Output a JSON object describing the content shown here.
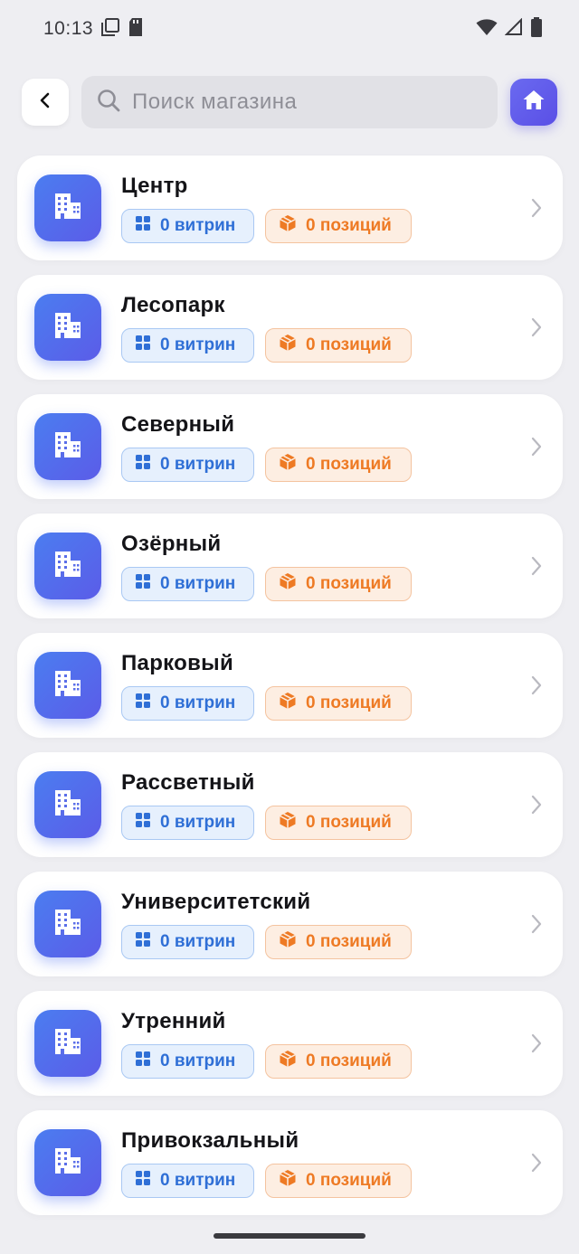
{
  "status_bar": {
    "time": "10:13"
  },
  "search": {
    "placeholder": "Поиск магазина",
    "value": ""
  },
  "stores": [
    {
      "name": "Центр",
      "showcases": "0 витрин",
      "positions": "0 позиций"
    },
    {
      "name": "Лесопарк",
      "showcases": "0 витрин",
      "positions": "0 позиций"
    },
    {
      "name": "Северный",
      "showcases": "0 витрин",
      "positions": "0 позиций"
    },
    {
      "name": "Озёрный",
      "showcases": "0 витрин",
      "positions": "0 позиций"
    },
    {
      "name": "Парковый",
      "showcases": "0 витрин",
      "positions": "0 позиций"
    },
    {
      "name": "Рассветный",
      "showcases": "0 витрин",
      "positions": "0 позиций"
    },
    {
      "name": "Университетский",
      "showcases": "0 витрин",
      "positions": "0 позиций"
    },
    {
      "name": "Утренний",
      "showcases": "0 витрин",
      "positions": "0 позиций"
    },
    {
      "name": "Привокзальный",
      "showcases": "0 витрин",
      "positions": "0 позиций"
    }
  ],
  "icons": {
    "back": "chevron-left-icon",
    "search": "search-icon",
    "home": "home-icon",
    "store": "building-icon",
    "showcases": "grid-icon",
    "positions": "box-icon",
    "open": "chevron-right-icon"
  },
  "colors": {
    "accent": "#5a5ce8",
    "blue_badge_text": "#2f6fd6",
    "orange_badge_text": "#ee7a24",
    "background": "#eeeef2"
  }
}
